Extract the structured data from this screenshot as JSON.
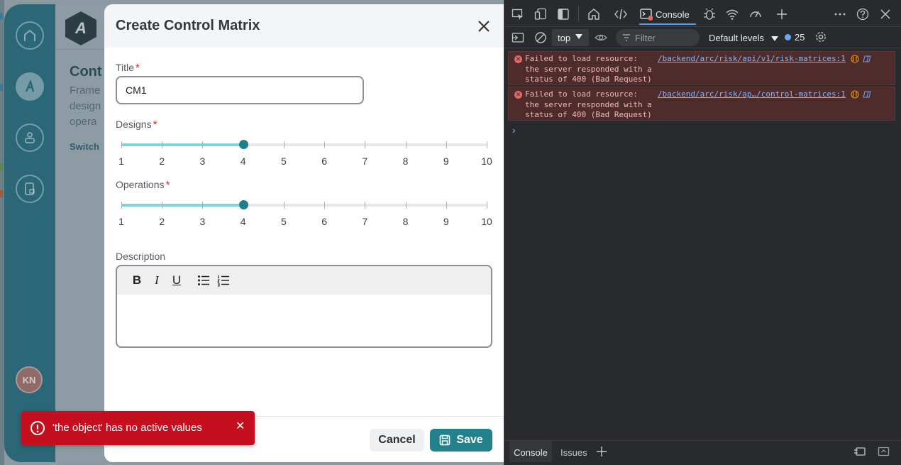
{
  "app": {
    "nav": [
      "home-icon",
      "logo-nav-icon",
      "user-settings-icon",
      "document-lock-icon"
    ],
    "avatar_initials": "KN",
    "background": {
      "title": "Cont",
      "desc_lines": [
        "Frame",
        "design",
        "opera"
      ],
      "link": "Switch"
    }
  },
  "modal": {
    "title": "Create Control Matrix",
    "title_field": {
      "label": "Title",
      "required": "*",
      "value": "CM1"
    },
    "designs": {
      "label": "Designs",
      "required": "*",
      "value": 4,
      "min": 1,
      "max": 10
    },
    "operations": {
      "label": "Operations",
      "required": "*",
      "value": 4,
      "min": 1,
      "max": 10
    },
    "ticks": [
      "1",
      "2",
      "3",
      "4",
      "5",
      "6",
      "7",
      "8",
      "9",
      "10"
    ],
    "description": {
      "label": "Description",
      "toolbar": {
        "bold": "B",
        "italic": "I",
        "underline": "U"
      }
    },
    "cancel_label": "Cancel",
    "save_label": "Save"
  },
  "toast": {
    "message": "'the object' has no active values",
    "close": "✕"
  },
  "devtools": {
    "console_tab": "Console",
    "context": "top",
    "filter_placeholder": "Filter",
    "levels": "Default levels",
    "issues_count": "25",
    "logs": [
      {
        "message": "Failed to load resource:\nthe server responded with a\nstatus of 400 (Bad Request)",
        "source": "/backend/arc/risk/api/v1/risk-matrices:1"
      },
      {
        "message": "Failed to load resource:\nthe server responded with a\nstatus of 400 (Bad Request)",
        "source": "/backend/arc/risk/ap…/control-matrices:1"
      }
    ],
    "prompt": "›",
    "drawer_tabs": [
      "Console",
      "Issues"
    ]
  },
  "colors": {
    "accent": "#22818a",
    "slider_fill": "#7fd3dd",
    "error": "#c50f1f",
    "rail": "#2c6777"
  }
}
